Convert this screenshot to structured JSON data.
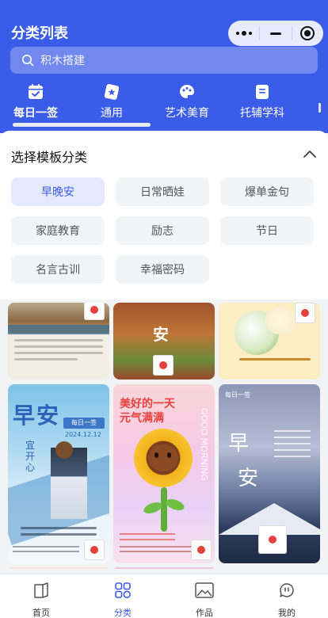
{
  "header": {
    "title": "分类列表",
    "search_placeholder": "积木搭建"
  },
  "tabs": [
    {
      "label": "每日一签",
      "icon": "calendar-check-icon",
      "active": true
    },
    {
      "label": "通用",
      "icon": "star-card-icon",
      "active": false
    },
    {
      "label": "艺术美育",
      "icon": "palette-icon",
      "active": false
    },
    {
      "label": "托辅学科",
      "icon": "book-icon",
      "active": false
    }
  ],
  "panel": {
    "title": "选择模板分类",
    "chips": [
      {
        "label": "早晚安",
        "selected": true
      },
      {
        "label": "日常晒娃",
        "selected": false
      },
      {
        "label": "爆单金句",
        "selected": false
      },
      {
        "label": "家庭教育",
        "selected": false
      },
      {
        "label": "励志",
        "selected": false
      },
      {
        "label": "节日",
        "selected": false
      },
      {
        "label": "名言古训",
        "selected": false
      },
      {
        "label": "幸福密码",
        "selected": false
      }
    ]
  },
  "cards": {
    "c2_big": "安",
    "c4_stamp": "每日一签",
    "c4_date": "2024.12.12",
    "c4_big": "早安",
    "c4_sub": "宜开心",
    "c5_head1": "美好的一天",
    "c5_head2": "元气满满",
    "c5_side": "GOOD MORNING",
    "c6_stamp": "每日一签",
    "c6_big1": "早",
    "c6_big2": "安"
  },
  "bottom_nav": [
    {
      "label": "首页",
      "icon": "book-open-icon",
      "active": false
    },
    {
      "label": "分类",
      "icon": "grid-icon",
      "active": true
    },
    {
      "label": "作品",
      "icon": "image-icon",
      "active": false
    },
    {
      "label": "我的",
      "icon": "chat-face-icon",
      "active": false
    }
  ],
  "colors": {
    "accent": "#3b5ce8",
    "chip_selected_bg": "#e4e9fd"
  }
}
